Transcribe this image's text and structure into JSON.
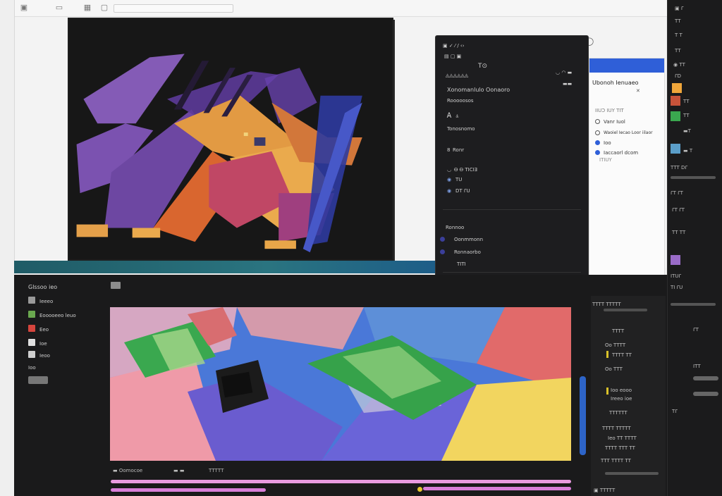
{
  "toolbar": {
    "icons": [
      "app-icon",
      "folder-icon",
      "grid-icon",
      "tab-icon",
      "menu-icon",
      "close-icon"
    ],
    "center_label": "▬▬▬▬▬",
    "right_controls": [
      "◐",
      "◯"
    ]
  },
  "dark_panel": {
    "header_icons": "▣ ✓ ⁄ /  ‹›",
    "row1": "▤ ▢ ▣",
    "row1b": "T⊙",
    "row1c": "◡ ◠ ▬",
    "header_label": "◬◬◬◬◬◬",
    "title": "Xonomanlulo Oonaoro",
    "subtitle": "Rooooosos",
    "items": [
      {
        "icon": "Ꭺ",
        "label": "ꕊ"
      },
      {
        "icon": "",
        "label": "Tonosnomo"
      },
      {
        "icon": "8",
        "label": "Ronr"
      },
      {
        "icon": "◡",
        "label": "Ꮎ Ꮎ ꓔꓲꓚꓲꓱ"
      },
      {
        "icon": "◉",
        "label": "ꓔꓴ"
      },
      {
        "icon": "◉",
        "label": "ꓓꓔ ꓩꓴ"
      }
    ],
    "lower_title": "Ronnoo",
    "lower_items": [
      "Oonmmonn",
      "Ronnaorbo",
      "ꓔꓲꓔꓲ"
    ],
    "bottom_icons": "▣ ◉ ⚲ ▢ ▤ ◐ ▨ ◑ ◯ ▦"
  },
  "white_panel": {
    "title": "Ubonoh Ienuaeo",
    "close": "✕",
    "subtitle": "ꓲꓲꓴꓛ ꓲꓴꓬ ꓔꓲꓔ",
    "options": [
      {
        "label": "Vanr Iuol",
        "selected": false
      },
      {
        "label": "Waoiel Iecao Loor iilaor",
        "selected": false
      },
      {
        "label": "Ioo",
        "selected": true
      },
      {
        "label": "Iaccaorl dcom",
        "selected": true
      }
    ],
    "option_footer": "ꓲꓔꓲꓴꓬ"
  },
  "right_strip": {
    "labels": [
      "▣ ꓩ",
      "ꓔꓔ",
      "ꓔ ꓔ",
      "ꓔꓔ",
      "◉ ꓔꓔ",
      "ꓩꓓ",
      "ꓔꓔ",
      "ꓔꓔ",
      "▬ꓔ",
      "▬ ꓔ",
      "ꓔꓔꓔ ꓓꓩ",
      "ꓩꓔ ꓩꓔ",
      "ꓩꓔ ꓩꓔ",
      "ꓔꓔ ꓔꓔ",
      "ꓲꓔꓴꓩ",
      "ꓔꓲ ꓩꓴ",
      "ꓩꓔ",
      "ꓲꓔꓔ",
      "ꓔꓩ"
    ],
    "swatches": [
      "#f0a63a",
      "#c7533a",
      "#3aa84f",
      "#5b9ec9",
      "#9a6cc8"
    ]
  },
  "layers": {
    "panel_title": "Glssoo ieo",
    "items": [
      {
        "label": "Ieeeo",
        "color": "#9a9a9a"
      },
      {
        "label": "Eooooeeo leuo",
        "color": "#6aa84f"
      },
      {
        "label": "Eeo",
        "color": "#d6453d"
      },
      {
        "label": "Ioe",
        "color": "#e0e0e0"
      },
      {
        "label": "Ieoo",
        "color": "#cfcfcf"
      },
      {
        "label": "Ioo",
        "color": ""
      }
    ],
    "button_label": ""
  },
  "timeline": {
    "label1": "▬ Oomocoe",
    "label2": "▬ ▬",
    "label3": "ꓔꓔꓔꓔꓔ",
    "bar_color_main": "#e99be0",
    "bar_color_second": "#d97ed9",
    "dot_color": "#e6c72d"
  },
  "inspector": {
    "header": "ꓔꓔꓔꓔ ꓔꓔꓔꓔꓔ",
    "header2": "ꓔꓔꓔꓔ",
    "items": [
      "Oo ꓔꓔꓔꓔ",
      "ꓔꓔꓔꓔ ꓔꓔ",
      "Oo ꓔꓔꓔ",
      "Ioo eooo",
      "Ireeo ioe",
      "ꓔꓔꓔꓔꓔꓔ",
      "ꓔꓔꓔꓔ ꓔꓔꓔꓔꓔ",
      "Ieo ꓔꓔ ꓔꓔꓔꓔ",
      "ꓔꓔꓔꓔ ꓔꓔꓔ ꓔꓔ",
      "ꓔꓔꓔ ꓔꓔꓔꓔ ꓔꓔ"
    ],
    "footer": "▣ ꓔꓔꓔꓔꓔ"
  }
}
